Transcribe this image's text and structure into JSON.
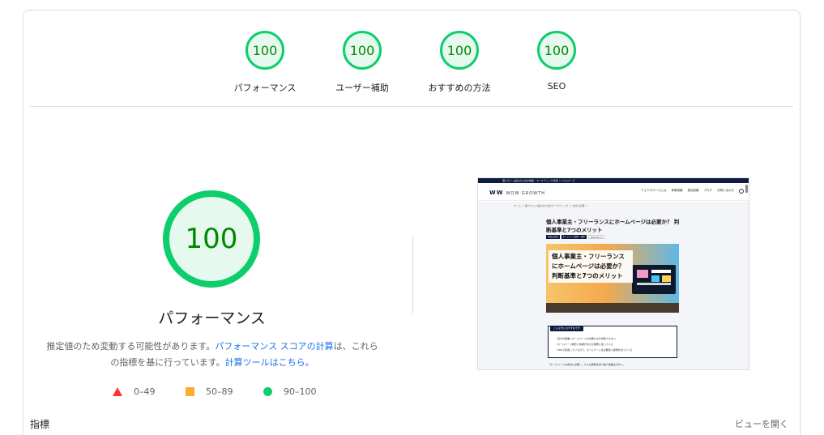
{
  "categories": [
    {
      "score": "100",
      "label": "パフォーマンス"
    },
    {
      "score": "100",
      "label": "ユーザー補助"
    },
    {
      "score": "100",
      "label": "おすすめの方法"
    },
    {
      "score": "100",
      "label": "SEO"
    }
  ],
  "main": {
    "score": "100",
    "title": "パフォーマンス",
    "desc_part1": "推定値のため変動する可能性があります。",
    "desc_link1": "パフォーマンス スコアの計算",
    "desc_part2": "は、これらの指標を基に行っています。",
    "desc_link2": "計算ツールはこちら。"
  },
  "legend": [
    {
      "range": "0–49",
      "color": "#ff3333"
    },
    {
      "range": "50–89",
      "color": "#ffaa33"
    },
    {
      "range": "90–100",
      "color": "#0cce6b"
    }
  ],
  "thumbnail": {
    "topbar": "個人サイト設計のための規格・マーケティング支援｜フォロワーズ",
    "logo_mark": "WW",
    "logo_text": "WOW GROWTH",
    "nav": [
      "ウォウグロースとは",
      "事業実績",
      "発信実績",
      "ブログ",
      "お問い合わせ"
    ],
    "breadcrumb": "ホーム ＞ 個人サイト設計のためのマーケティング ＞ 本日の記事 ＞",
    "headline": "個人事業主・フリーランスにホームページは必要か？ 判断基準と7つのメリット",
    "tags": [
      "本日の記事",
      "ホームページ制作・運営",
      "2024.05.17"
    ],
    "hero_text": "個人事業主・フリーランスにホームページは必要か？判断基準と7つのメリット",
    "box_title": "こんな方におすすめです",
    "box_lines": [
      "・自分の事業にホームページが必要なのか判断できない",
      "・ホームページ制作に依頼があるか疑問に思っている",
      "・SNSで集客しているので、ホームページは必要性に疑問を持っている"
    ],
    "foot": "「ホームページは本当に必要？」そんな疑問を持つ個人事業主の方へ。"
  },
  "footer": {
    "metrics_label": "指標",
    "expand_label": "ビューを開く"
  },
  "colors": {
    "pass": "#0cce6b",
    "pass_text": "#008800",
    "link": "#1a73e8"
  }
}
